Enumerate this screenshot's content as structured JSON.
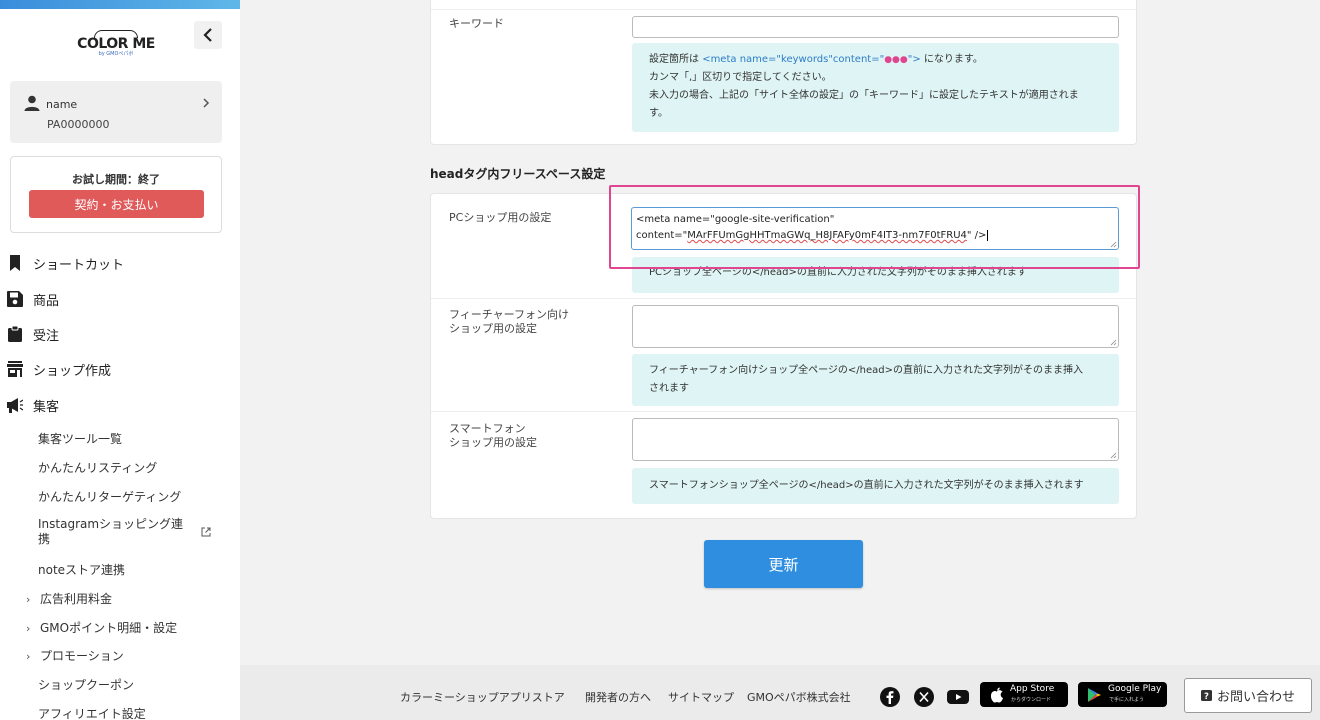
{
  "sidebar": {
    "logo": {
      "main": "COLOR ME",
      "sub": "by GMOペパボ"
    },
    "user": {
      "name": "name",
      "id": "PA0000000"
    },
    "trial": {
      "label": "お試し期間：終了",
      "button": "契約・お支払い"
    },
    "nav": [
      {
        "label": "ショートカット",
        "icon": "bookmark-icon"
      },
      {
        "label": "商品",
        "icon": "save-icon"
      },
      {
        "label": "受注",
        "icon": "clipboard-icon"
      },
      {
        "label": "ショップ作成",
        "icon": "store-icon"
      },
      {
        "label": "集客",
        "icon": "megaphone-icon"
      }
    ],
    "sub_items": [
      {
        "label": "集客ツール一覧"
      },
      {
        "label": "かんたんリスティング"
      },
      {
        "label": "かんたんリターゲティング"
      },
      {
        "label": "Instagramショッピング連",
        "label2": "携"
      },
      {
        "label": "noteストア連携"
      },
      {
        "label": "広告利用料金"
      },
      {
        "label": "GMOポイント明細・設定"
      },
      {
        "label": "プロモーション"
      },
      {
        "label": "ショップクーポン"
      },
      {
        "label": "アフィリエイト設定"
      }
    ]
  },
  "main": {
    "keyword": {
      "label": "キーワード",
      "value": "",
      "hint_line1_prefix": "設定箇所は ",
      "hint_code": "<meta name=\"keywords\"content=\"",
      "hint_dots": "●●●",
      "hint_code_end": "\">",
      "hint_line1_suffix": " になります。",
      "hint_line2": "カンマ「,」区切りで指定してください。",
      "hint_line3": "未入力の場合、上記の「サイト全体の設定」の「キーワード」に設定したテキストが適用されま",
      "hint_line4": "す。"
    },
    "section_title": "headタグ内フリースペース設定",
    "pc": {
      "label": "PCショップ用の設定",
      "value_line1": "<meta name=\"google-site-verification\"",
      "value_line2_a": "content=\"",
      "value_line2_b": "MArFFUmGgHHTmaGWq_H8JFAFy0mF4IT3-nm7F0tFRU4",
      "value_line2_c": "\" />",
      "hint": "PCショップ全ページの</head>の直前に入力された文字列がそのまま挿入されます"
    },
    "feature": {
      "label_line1": "フィーチャーフォン向け",
      "label_line2": "ショップ用の設定",
      "value": "",
      "hint_line1": "フィーチャーフォン向けショップ全ページの</head>の直前に入力された文字列がそのまま挿入",
      "hint_line2": "されます"
    },
    "smart": {
      "label_line1": "スマートフォン",
      "label_line2": "ショップ用の設定",
      "value": "",
      "hint": "スマートフォンショップ全ページの</head>の直前に入力された文字列がそのまま挿入されます"
    },
    "update_button": "更新"
  },
  "footer": {
    "links": [
      "カラーミーショップアプリストア",
      "開発者の方へ",
      "サイトマップ",
      "GMOペパボ株式会社"
    ],
    "sns": [
      "facebook-icon",
      "x-icon",
      "youtube-icon"
    ],
    "app_store": {
      "main": "App Store",
      "sub": "からダウンロード"
    },
    "google_play": {
      "main": "Google Play",
      "sub": "で手に入れよう"
    },
    "contact": "お問い合わせ"
  },
  "colors": {
    "accent": "#2f8ee0",
    "trial_button": "#e05a5a",
    "hint_bg": "#dff4f4",
    "highlight": "#e0458f"
  }
}
